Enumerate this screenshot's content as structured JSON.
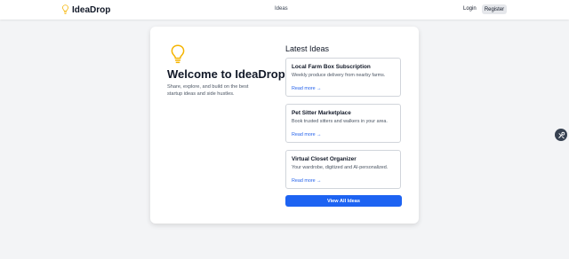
{
  "header": {
    "brand": "IdeaDrop",
    "nav_ideas": "Ideas",
    "login": "Login",
    "register": "Register"
  },
  "hero": {
    "title": "Welcome to IdeaDrop",
    "subtitle": "Share, explore, and build on the best startup ideas and side hustles."
  },
  "latest": {
    "title": "Latest Ideas",
    "items": [
      {
        "title": "Local Farm Box Subscription",
        "description": "Weekly produce delivery from nearby farms.",
        "link": "Read more →"
      },
      {
        "title": "Pet Sitter Marketplace",
        "description": "Book trusted sitters and walkers in your area.",
        "link": "Read more →"
      },
      {
        "title": "Virtual Closet Organizer",
        "description": "Your wardrobe, digitized and AI-personalized.",
        "link": "Read more →"
      }
    ],
    "view_all": "View All Ideas"
  },
  "colors": {
    "accent": "#1d63f2",
    "bulb": "#f5b400",
    "link": "#2563eb"
  },
  "icons": {
    "brand": "lightbulb-icon",
    "hero": "lightbulb-icon",
    "side_tool": "tools-icon"
  }
}
